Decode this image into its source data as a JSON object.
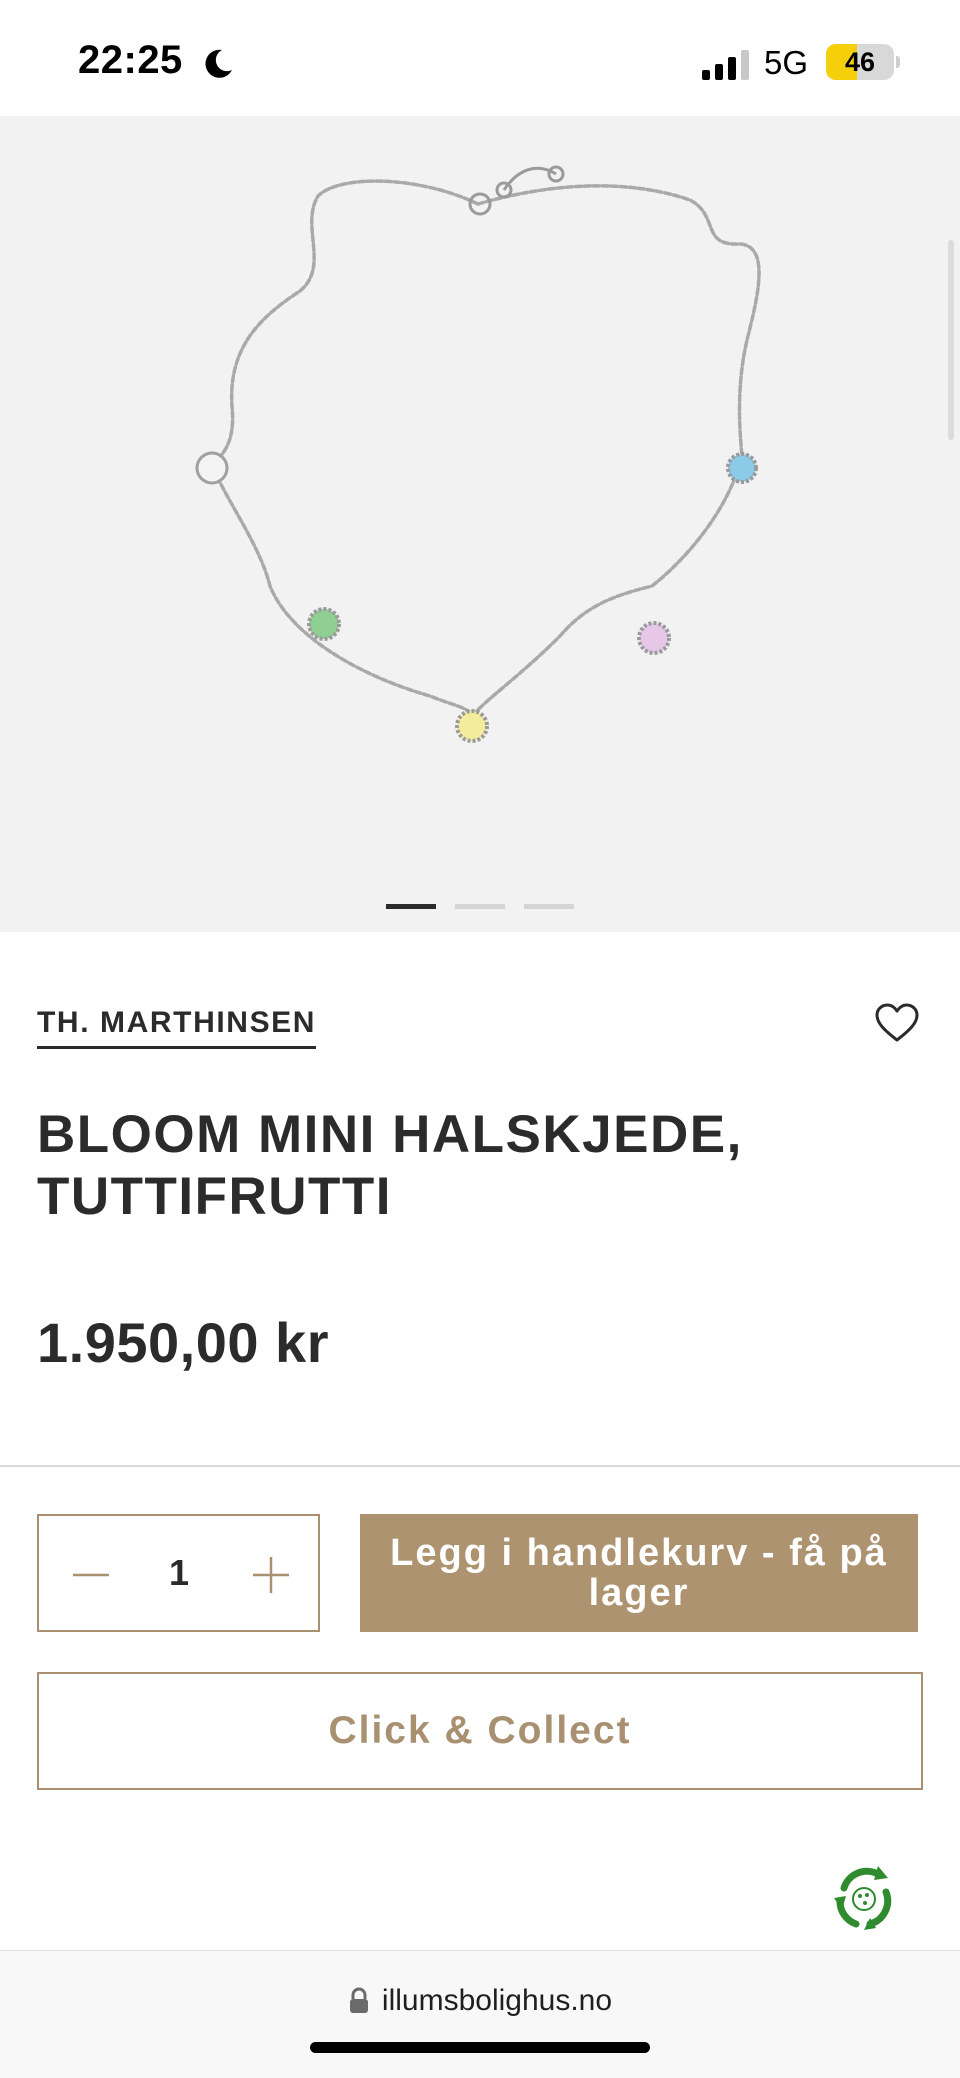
{
  "status_bar": {
    "time": "22:25",
    "network": "5G",
    "battery_level": "46",
    "battery_fraction": 0.46,
    "icons": [
      "moon-icon",
      "signal-icon",
      "battery-icon"
    ]
  },
  "gallery": {
    "image": "necklace-with-colored-charms",
    "charm_colors": [
      "#f4f4f4",
      "#8fcf94",
      "#f2ec9c",
      "#e6c7e8",
      "#8ccbe8"
    ],
    "page_count": 3,
    "active_page": 1
  },
  "product": {
    "brand": "TH. MARTHINSEN",
    "title": "BLOOM MINI HALSKJEDE, TUTTIFRUTTI",
    "price": "1.950,00 kr",
    "favorite_icon": "heart-icon"
  },
  "purchase": {
    "quantity": "1",
    "minus_icon": "minus-icon",
    "plus_icon": "plus-icon",
    "add_to_cart_label": "Legg i handlekurv - få på lager",
    "click_collect_label": "Click & Collect",
    "accent_color": "#ad9370"
  },
  "eco_badge": {
    "icon": "recycle-icon",
    "color": "#2e8b2e"
  },
  "browser": {
    "url": "illumsbolighus.no",
    "lock_icon": "lock-icon"
  }
}
